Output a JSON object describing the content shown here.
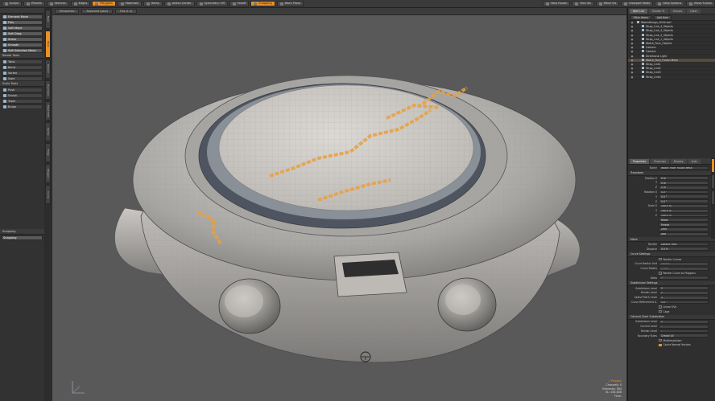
{
  "toolbar": {
    "buttons": [
      {
        "label": "Sculpt",
        "on": false
      },
      {
        "label": "Presets",
        "on": false
      },
      {
        "label": "Vertices",
        "on": false
      },
      {
        "label": "Edges",
        "on": false
      },
      {
        "label": "Polygons",
        "on": true
      },
      {
        "label": "Materials",
        "on": false
      },
      {
        "label": "Items",
        "on": false
      },
      {
        "label": "Action Center",
        "on": false
      },
      {
        "label": "Symmetry: Off",
        "on": false
      },
      {
        "label": "Falloff",
        "on": false
      },
      {
        "label": "Snapping",
        "on": true
      },
      {
        "label": "Work Plane",
        "on": false
      }
    ],
    "right_buttons": [
      "New Fusion",
      "Tree Vis",
      "Mesh Vis",
      "Viewport Mode",
      "Strip Options",
      "Move Fusion"
    ]
  },
  "left_panel": {
    "sections": [
      {
        "title": "",
        "tools": [
          "Element Move",
          "Flex",
          "Soft Move",
          "Soft Drag",
          "Shear",
          "Smooth",
          "Soft Selection Move"
        ],
        "active": [
          0,
          1,
          2,
          3,
          4,
          5,
          6
        ]
      },
      {
        "title": "Rotate Tools",
        "tools": [
          "Twist",
          "Bend",
          "Vortex",
          "Swirl"
        ],
        "active": []
      },
      {
        "title": "Scale Tools",
        "tools": [
          "Push",
          "Sculpt",
          "Taper",
          "Bulge"
        ],
        "active": []
      }
    ],
    "snapping": {
      "title": "Snapping",
      "field": "Snapping"
    },
    "vtabs": [
      "Basic",
      "Tools",
      "Deform",
      "Duplicate",
      "Mesh Edit",
      "Vertex",
      "Edge",
      "Polygon",
      "Curve"
    ]
  },
  "viewport": {
    "tabs": [
      "Perspective",
      "Advanced (pass)",
      "Flex (1.0)"
    ],
    "info": [
      "1 Polygon",
      "Channels: 0",
      "Elements: 584",
      "GL: 284,648",
      "Time:"
    ]
  },
  "right_panel": {
    "tabs": [
      "Item List",
      "Shader Tr.",
      "Groups",
      "Lister"
    ],
    "filter": "Filter Items",
    "add_item": "Add Item",
    "items": [
      {
        "label": "WatchDesign_0004.lxo*",
        "level": 0,
        "sel": false
      },
      {
        "label": "Strap_Link_4_Objects",
        "level": 1,
        "sel": false
      },
      {
        "label": "Strap_Link_3_Objects",
        "level": 1,
        "sel": false
      },
      {
        "label": "Strap_Link_2_Objects",
        "level": 1,
        "sel": false
      },
      {
        "label": "Strap_Link_1_Objects",
        "level": 1,
        "sel": false
      },
      {
        "label": "Watch_Face_Objects",
        "level": 1,
        "sel": false
      },
      {
        "label": "Camera",
        "level": 1,
        "sel": false
      },
      {
        "label": "Camera",
        "level": 1,
        "sel": false
      },
      {
        "label": "Directional Light",
        "level": 1,
        "sel": false
      },
      {
        "label": "Watch_Face_Fusion Mesh",
        "level": 1,
        "sel": true
      },
      {
        "label": "Strap_Link1",
        "level": 1,
        "sel": false
      },
      {
        "label": "Strap_Link2",
        "level": 1,
        "sel": false
      },
      {
        "label": "Strap_Link3",
        "level": 1,
        "sel": false
      },
      {
        "label": "Strap_Link4",
        "level": 1,
        "sel": false
      }
    ],
    "prop_tabs": [
      "Properties",
      "Channels",
      "Display",
      "Lists"
    ],
    "name_label": "Name",
    "name_value": "Watch_Face_Fusion Mesh",
    "groups": [
      {
        "title": "Transform",
        "rows": [
          {
            "k": "Position X",
            "v": "0 m"
          },
          {
            "k": "Y",
            "v": "0 m"
          },
          {
            "k": "Z",
            "v": "0 m"
          },
          {
            "k": "Rotation X",
            "v": "0.0 °"
          },
          {
            "k": "Y",
            "v": "0.0 °"
          },
          {
            "k": "Z",
            "v": "0.0 °"
          },
          {
            "k": "Scale X",
            "v": "100.0 %"
          },
          {
            "k": "Y",
            "v": "100.0 %"
          },
          {
            "k": "Z",
            "v": "100.0 %"
          },
          {
            "k": "",
            "v": "Reset"
          },
          {
            "k": "",
            "v": "Freeze"
          },
          {
            "k": "",
            "v": "Zero"
          },
          {
            "k": "",
            "v": "Add"
          }
        ]
      },
      {
        "title": "Mesh",
        "rows": [
          {
            "k": "Render",
            "v": "Default (Yes)"
          },
          {
            "k": "Dissolve",
            "v": "0.0 %"
          }
        ]
      },
      {
        "title": "Curve Settings",
        "rows": [
          {
            "k": "",
            "v": "Render Curves",
            "chk": true,
            "on": false
          },
          {
            "k": "Curve Radius Unit",
            "v": "Meters",
            "dim": true
          },
          {
            "k": "Curve Radius",
            "v": "5 mm",
            "dim": true
          },
          {
            "k": "",
            "v": "Render Curve as Polygons",
            "chk": true,
            "on": false
          },
          {
            "k": "Sides",
            "v": "4",
            "dim": true
          }
        ]
      },
      {
        "title": "Subdivision Settings",
        "rows": [
          {
            "k": "Subdivision Level",
            "v": "2"
          },
          {
            "k": "Render Level",
            "v": "2"
          },
          {
            "k": "Spline Patch Level",
            "v": "3"
          },
          {
            "k": "Curve Refinement A.",
            "v": "5.0 °"
          },
          {
            "k": "",
            "v": "Linear UVs",
            "chk": true,
            "on": false
          },
          {
            "k": "",
            "v": "Cage",
            "chk": true,
            "on": false
          }
        ]
      },
      {
        "title": "Catmull-Clark Subdivision",
        "rows": [
          {
            "k": "Subdivision Level",
            "v": "2"
          },
          {
            "k": "Current Level",
            "v": "2",
            "dim": true
          },
          {
            "k": "Render Level",
            "v": "2",
            "dim": true
          },
          {
            "k": "Boundary Rules",
            "v": "Crease All"
          },
          {
            "k": "",
            "v": "Multiresolution",
            "chk": true,
            "on": false
          },
          {
            "k": "",
            "v": "Cache Normal Vectors",
            "chk": true,
            "on": true
          }
        ]
      }
    ]
  },
  "colors": {
    "accent": "#e8902a",
    "bg": "#595959",
    "panel": "#323232",
    "mesh": "#d6d3cf",
    "highlight": "#e8a040"
  }
}
